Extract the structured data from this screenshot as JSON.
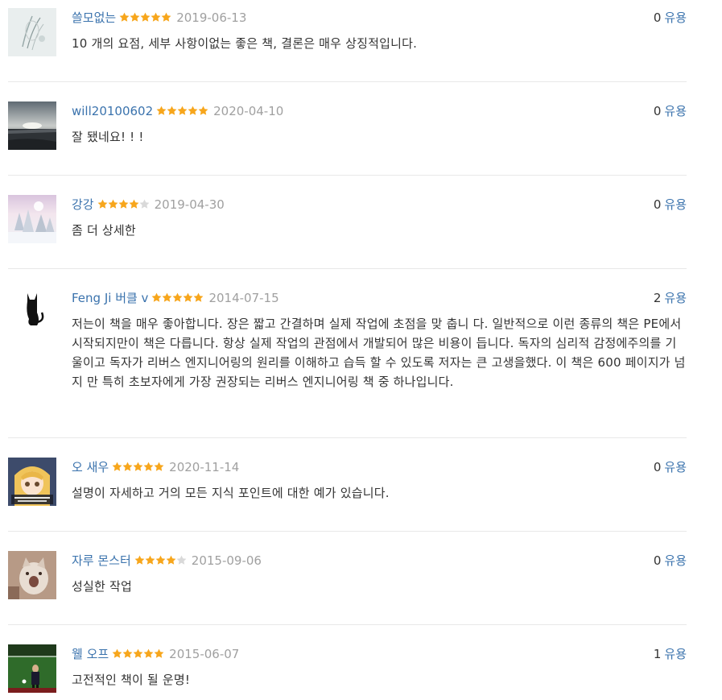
{
  "helpful_label": "유용",
  "colors": {
    "link": "#3b73ad",
    "date": "#a0a0a0",
    "star_on": "#f7a61c",
    "star_off": "#d9d9d9"
  },
  "reviews": [
    {
      "user": "쓸모없는",
      "rating": 5,
      "date": "2019-06-13",
      "helpful_count": "0",
      "text": "10 개의 요점, 세부 사항이없는 좋은 책, 결론은 매우 상징적입니다.",
      "avatar": "sketch-avatar"
    },
    {
      "user": "will20100602",
      "rating": 5,
      "date": "2020-04-10",
      "helpful_count": "0",
      "text": "잘 됐네요! ! !",
      "avatar": "lake-sunset-avatar"
    },
    {
      "user": "강강",
      "rating": 4,
      "date": "2019-04-30",
      "helpful_count": "0",
      "text": "좀 더 상세한",
      "avatar": "snowy-forest-avatar"
    },
    {
      "user": "Feng Ji 버클 v",
      "rating": 5,
      "date": "2014-07-15",
      "helpful_count": "2",
      "text": "저는이 책을 매우 좋아합니다. 장은 짧고 간결하며 실제 작업에 초점을 맞 춥니 다. 일반적으로 이런 종류의 책은 PE에서 시작되지만이 책은 다릅니다. 항상 실제 작업의 관점에서 개발되어 많은 비용이 듭니다. 독자의 심리적 감정에주의를 기울이고 독자가 리버스 엔지니어링의 원리를 이해하고 습득 할 수 있도록 저자는 큰 고생을했다. 이 책은 600 페이지가 넘지 만 특히 초보자에게 가장 권장되는 리버스 엔지니어링 책 중 하나입니다.",
      "avatar": "black-cat-avatar"
    },
    {
      "user": "오 새우",
      "rating": 5,
      "date": "2020-11-14",
      "helpful_count": "0",
      "text": "설명이 자세하고 거의 모든 지식 포인트에 대한 예가 있습니다.",
      "avatar": "anime-girl-avatar"
    },
    {
      "user": "자루 몬스터",
      "rating": 4,
      "date": "2015-09-06",
      "helpful_count": "0",
      "text": "성실한 작업",
      "avatar": "kitten-avatar"
    },
    {
      "user": "웰 오프",
      "rating": 5,
      "date": "2015-06-07",
      "helpful_count": "1",
      "text": "고전적인 책이 될 운명!",
      "avatar": "soccer-field-avatar"
    }
  ]
}
